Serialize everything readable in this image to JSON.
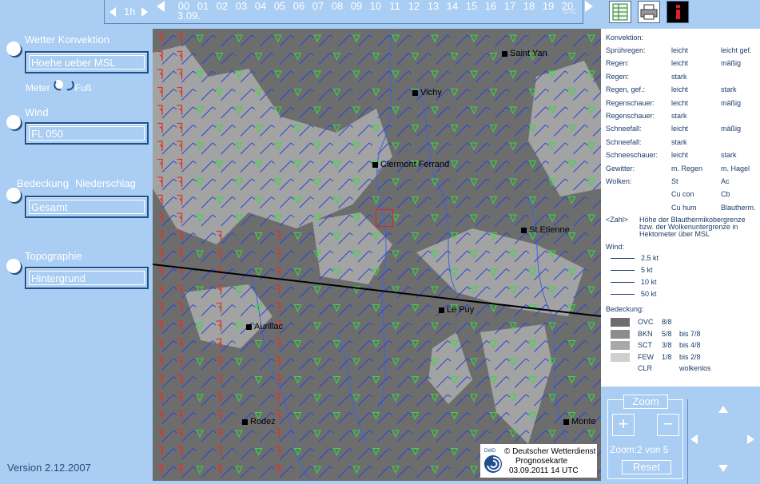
{
  "timebar": {
    "step_label": "1h",
    "hours": [
      "00",
      "01",
      "02",
      "03",
      "04",
      "05",
      "06",
      "07",
      "08",
      "09",
      "10",
      "11",
      "12",
      "13",
      "14",
      "15",
      "16",
      "17",
      "18",
      "19",
      "20"
    ],
    "selected_hour": "14",
    "date_label": "3.09.",
    "utc_label": "UTC"
  },
  "left_panel": {
    "convection_title": "Wetter Konvektion",
    "convection_field": "Hoehe ueber MSL",
    "unit_meter": "Meter",
    "unit_foot": "Fuß",
    "wind_title": "Wind",
    "wind_field": "FL 050",
    "cover_title": "Bedeckung",
    "precip_title": "Niederschlag",
    "cover_field": "Gesamt",
    "topo_title": "Topographie",
    "topo_field": "Hintergrund",
    "version": "Version 2.12.2007"
  },
  "map": {
    "cities": [
      {
        "name": "Saint Yan"
      },
      {
        "name": "Vichy"
      },
      {
        "name": "Clermont Ferrand"
      },
      {
        "name": "St.Etienne"
      },
      {
        "name": "Le Puy"
      },
      {
        "name": "Aurillac"
      },
      {
        "name": "Rodez"
      },
      {
        "name": "Monte"
      }
    ],
    "dwd_line1": "© Deutscher Wetterdienst",
    "dwd_line2": "Prognosekarte",
    "dwd_line3": "03.09.2011 14 UTC",
    "dwd_logo": "DWD"
  },
  "legend": {
    "convection_title": "Konvektion:",
    "rows": [
      {
        "label": "Sprühregen:",
        "a": "leicht",
        "b": "leicht gef."
      },
      {
        "label": "Regen:",
        "a": "leicht",
        "b": "mäßig"
      },
      {
        "label": "Regen:",
        "a": "stark",
        "b": ""
      },
      {
        "label": "Regen, gef.:",
        "a": "leicht",
        "b": "stark"
      },
      {
        "label": "Regenschauer:",
        "a": "leicht",
        "b": "mäßig"
      },
      {
        "label": "Regenschauer:",
        "a": "stark",
        "b": ""
      },
      {
        "label": "Schneefall:",
        "a": "leicht",
        "b": "mäßig"
      },
      {
        "label": "Schneefall:",
        "a": "stark",
        "b": ""
      },
      {
        "label": "Schneeschauer:",
        "a": "leicht",
        "b": "stark"
      },
      {
        "label": "Gewitter:",
        "a": "m. Regen",
        "b": "m. Hagel"
      },
      {
        "label": "Wolken:",
        "a": "St",
        "b": "Ac"
      },
      {
        "label": "",
        "a": "Cu con",
        "b": "Cb"
      },
      {
        "label": "",
        "a": "Cu hum",
        "b": "Blautherm."
      }
    ],
    "zahl_label": "<Zahl>",
    "zahl_text_1": "Höhe der Blauthermikobergrenze",
    "zahl_text_2": "bzw. der Wolkenuntergrenze in",
    "zahl_text_3": "Hektometer über MSL",
    "wind_title": "Wind:",
    "wind_rows": [
      "2,5 kt",
      "5 kt",
      "10 kt",
      "50 kt"
    ],
    "cover_title": "Bedeckung:",
    "cover_rows": [
      {
        "code": "OVC",
        "frac": "8/8",
        "range": "",
        "color": "#6d6d6d"
      },
      {
        "code": "BKN",
        "frac": "5/8",
        "range": "bis 7/8",
        "color": "#8d8d8d"
      },
      {
        "code": "SCT",
        "frac": "3/8",
        "range": "bis 4/8",
        "color": "#a8a8a8"
      },
      {
        "code": "FEW",
        "frac": "1/8",
        "range": "bis 2/8",
        "color": "#cfcfcf"
      },
      {
        "code": "CLR",
        "frac": "",
        "range": "wolkenlos",
        "color": "#ffffff"
      }
    ]
  },
  "zoom": {
    "title": "Zoom",
    "plus": "+",
    "minus": "−",
    "status": "Zoom:2 von 5",
    "reset": "Reset"
  },
  "icons": [
    "grid-view-icon",
    "printer-icon",
    "info-icon"
  ],
  "colors": {
    "ui_bg": "#a9cdf3",
    "wind_barb": "#2a46d8",
    "rain_symbol": "#33dd44",
    "thunder_symbol": "#d8362a",
    "map_dark": "#6d6d6d",
    "map_light": "#a9a9a9"
  }
}
